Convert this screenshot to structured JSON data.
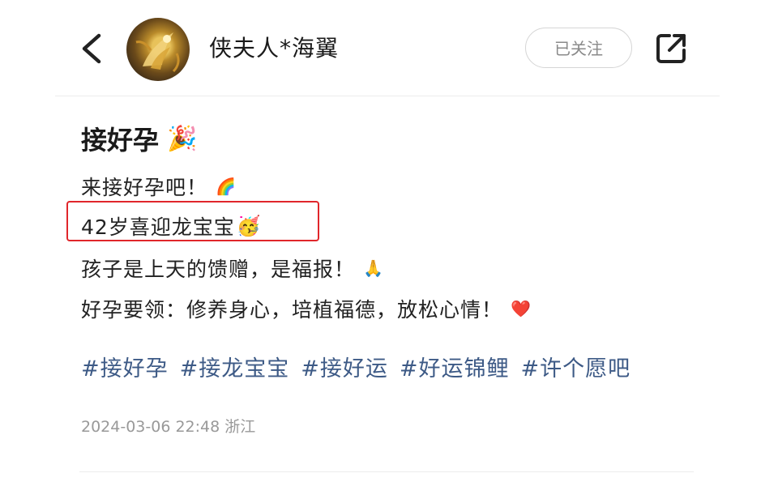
{
  "header": {
    "back_icon": "chevron-left-icon",
    "username": "侠夫人*海翼",
    "follow_label": "已关注",
    "share_icon": "share-external-icon"
  },
  "post": {
    "title": "接好孕",
    "title_emoji": "🎉",
    "lines": [
      {
        "text": "来接好孕吧！",
        "emoji": "🌈"
      },
      {
        "text": "42岁喜迎龙宝宝",
        "emoji": "🥳"
      },
      {
        "text": "孩子是上天的馈赠，是福报！",
        "emoji": "🙏"
      },
      {
        "text": "好孕要领：修养身心，培植福德，放松心情！",
        "emoji": "❤️"
      }
    ],
    "tags": [
      "#接好孕",
      "#接龙宝宝",
      "#接好运",
      "#好运锦鲤",
      "#许个愿吧"
    ],
    "meta": "2024-03-06 22:48 浙江"
  },
  "colors": {
    "highlight": "#e0262b",
    "tag": "#3d5a86",
    "meta": "#999999"
  }
}
